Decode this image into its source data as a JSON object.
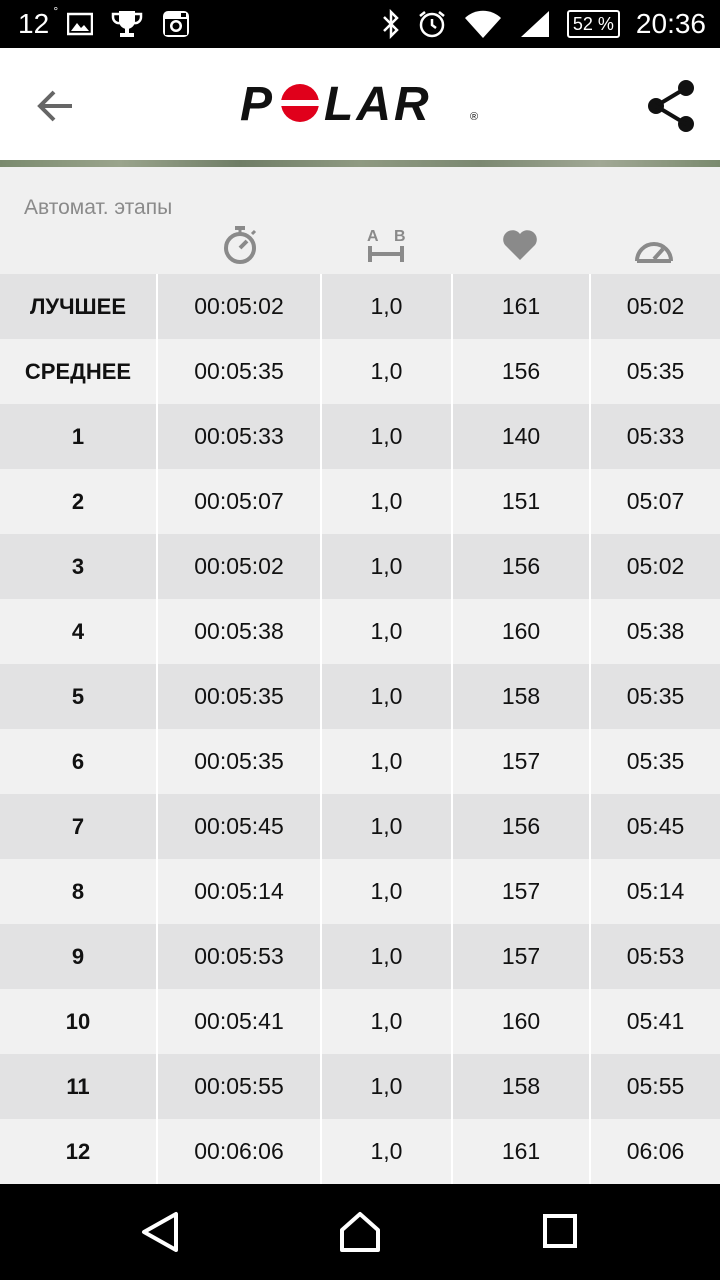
{
  "status_bar": {
    "temperature": "12",
    "degree": "°",
    "battery": "52 %",
    "time": "20:36",
    "icons": [
      "image-icon",
      "trophy-icon",
      "instagram-icon",
      "bluetooth-icon",
      "alarm-icon",
      "wifi-icon",
      "signal-icon",
      "battery-icon"
    ]
  },
  "app_bar": {
    "brand": "POLAR",
    "icons": [
      "back-arrow-icon",
      "polar-logo",
      "share-icon"
    ]
  },
  "section": {
    "title": "Автомат. этапы"
  },
  "columns": [
    {
      "name": "label",
      "icon": ""
    },
    {
      "name": "duration",
      "icon": "stopwatch-icon"
    },
    {
      "name": "distance",
      "icon": "distance-ab-icon"
    },
    {
      "name": "heart-rate",
      "icon": "heart-icon"
    },
    {
      "name": "pace",
      "icon": "speedometer-icon"
    }
  ],
  "rows": [
    {
      "label": "ЛУЧШЕЕ",
      "duration": "00:05:02",
      "distance": "1,0",
      "hr": "161",
      "pace": "05:02"
    },
    {
      "label": "СРЕДНЕЕ",
      "duration": "00:05:35",
      "distance": "1,0",
      "hr": "156",
      "pace": "05:35"
    },
    {
      "label": "1",
      "duration": "00:05:33",
      "distance": "1,0",
      "hr": "140",
      "pace": "05:33"
    },
    {
      "label": "2",
      "duration": "00:05:07",
      "distance": "1,0",
      "hr": "151",
      "pace": "05:07"
    },
    {
      "label": "3",
      "duration": "00:05:02",
      "distance": "1,0",
      "hr": "156",
      "pace": "05:02"
    },
    {
      "label": "4",
      "duration": "00:05:38",
      "distance": "1,0",
      "hr": "160",
      "pace": "05:38"
    },
    {
      "label": "5",
      "duration": "00:05:35",
      "distance": "1,0",
      "hr": "158",
      "pace": "05:35"
    },
    {
      "label": "6",
      "duration": "00:05:35",
      "distance": "1,0",
      "hr": "157",
      "pace": "05:35"
    },
    {
      "label": "7",
      "duration": "00:05:45",
      "distance": "1,0",
      "hr": "156",
      "pace": "05:45"
    },
    {
      "label": "8",
      "duration": "00:05:14",
      "distance": "1,0",
      "hr": "157",
      "pace": "05:14"
    },
    {
      "label": "9",
      "duration": "00:05:53",
      "distance": "1,0",
      "hr": "157",
      "pace": "05:53"
    },
    {
      "label": "10",
      "duration": "00:05:41",
      "distance": "1,0",
      "hr": "160",
      "pace": "05:41"
    },
    {
      "label": "11",
      "duration": "00:05:55",
      "distance": "1,0",
      "hr": "158",
      "pace": "05:55"
    },
    {
      "label": "12",
      "duration": "00:06:06",
      "distance": "1,0",
      "hr": "161",
      "pace": "06:06"
    }
  ],
  "nav_bar": {
    "icons": [
      "nav-back-icon",
      "nav-home-icon",
      "nav-recents-icon"
    ]
  },
  "colors": {
    "brand_red": "#e0001b",
    "row_odd": "#e2e2e3",
    "row_even": "#f1f1f1",
    "icon_gray": "#8a8a8a"
  }
}
